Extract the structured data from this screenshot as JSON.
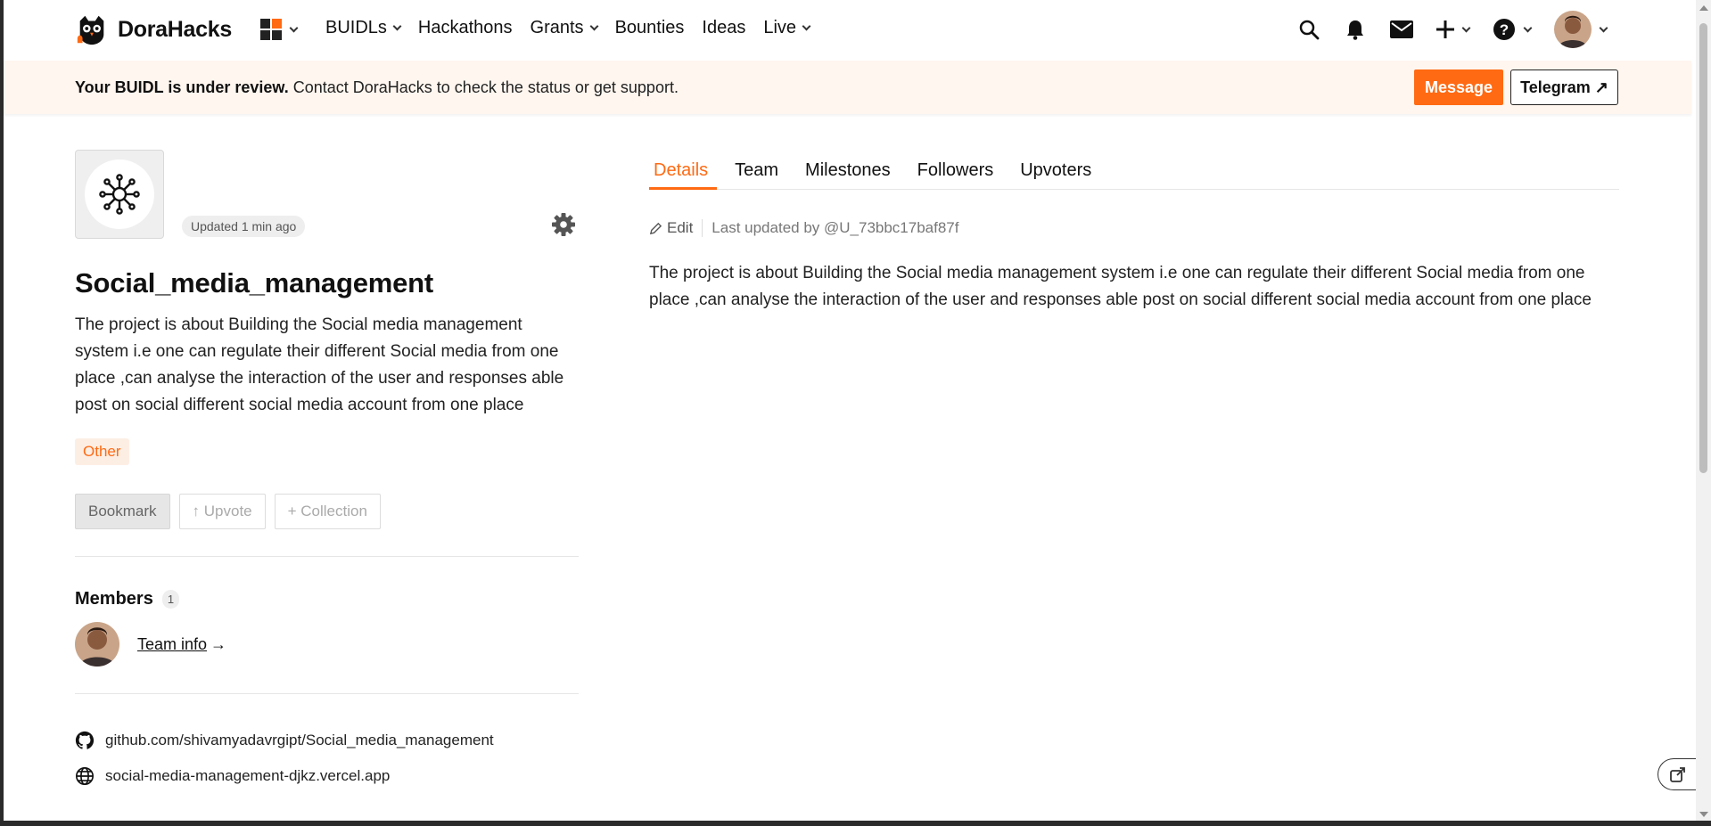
{
  "nav": {
    "brand": "DoraHacks",
    "menu": [
      {
        "label": "BUIDLs",
        "has_chevron": true
      },
      {
        "label": "Hackathons",
        "has_chevron": false
      },
      {
        "label": "Grants",
        "has_chevron": true
      },
      {
        "label": "Bounties",
        "has_chevron": false
      },
      {
        "label": "Ideas",
        "has_chevron": false
      },
      {
        "label": "Live",
        "has_chevron": true
      }
    ],
    "icons": [
      "apps-grid-icon",
      "search-icon",
      "bell-icon",
      "mail-icon",
      "plus-icon",
      "help-icon",
      "avatar"
    ]
  },
  "banner": {
    "bold": "Your BUIDL is under review.",
    "text": " Contact DoraHacks to check the status or get support.",
    "message_button": "Message",
    "telegram_button": "Telegram ↗"
  },
  "project": {
    "updated": "Updated 1 min ago",
    "title": "Social_media_management",
    "description": "The project is about Building the Social media management system i.e one can regulate their different Social media from one place ,can analyse the interaction of the user and responses able post on social different social media account from one place",
    "tag": "Other",
    "actions": {
      "bookmark": "Bookmark",
      "upvote": "↑ Upvote",
      "collection": "+ Collection"
    },
    "members": {
      "title": "Members",
      "count": "1",
      "team_info": "Team info",
      "arrow": "→"
    },
    "links": {
      "github": "github.com/shivamyadavrgipt/Social_media_management",
      "website": "social-media-management-djkz.vercel.app"
    }
  },
  "tabs": [
    "Details",
    "Team",
    "Milestones",
    "Followers",
    "Upvoters"
  ],
  "details": {
    "edit": "Edit",
    "last_updated": "Last updated by @U_73bbc17baf87f",
    "text": "The project is about Building the Social media management system i.e one can regulate their different Social media from one place ,can analyse the interaction of the user and responses able post on social different social media account from one place"
  },
  "colors": {
    "accent": "#ff6a13",
    "banner_bg": "#fff6ef"
  }
}
